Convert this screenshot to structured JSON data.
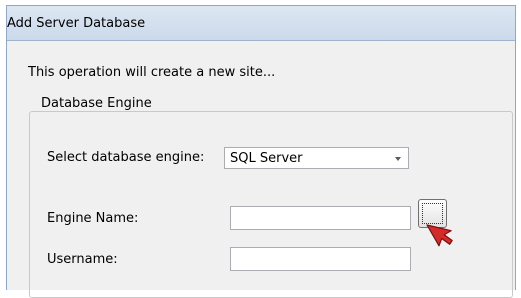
{
  "window": {
    "title": "Add Server Database"
  },
  "intro_text": "This operation will create a new site...",
  "database_engine_group": {
    "label": "Database Engine",
    "engine_select": {
      "label": "Select database engine:",
      "value": "SQL Server"
    },
    "engine_name": {
      "label": "Engine Name:",
      "value": ""
    },
    "browse_button": {
      "label": ""
    },
    "username": {
      "label": "Username:",
      "value": ""
    }
  },
  "icons": {
    "dropdown": "chevron-down-icon",
    "cursor": "mouse-pointer-icon"
  },
  "colors": {
    "cursor": "#d42a2a",
    "titlebar": "#cbd9ea",
    "window_border": "#8ea8c9"
  }
}
